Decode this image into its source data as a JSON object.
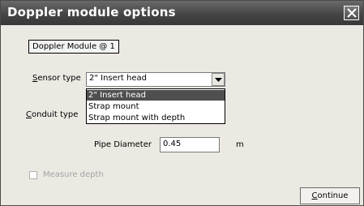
{
  "window": {
    "title": "Doppler module options"
  },
  "module": {
    "label": "Doppler Module @ 1"
  },
  "sensor": {
    "label": "Sensor type",
    "selected": "2\" Insert head",
    "options": [
      "2\" Insert head",
      "Strap mount",
      "Strap mount with depth"
    ],
    "highlighted_index": 0
  },
  "conduit": {
    "label": "Conduit type"
  },
  "pipe": {
    "label": "Pipe Diameter",
    "value": "0.45",
    "unit": "m"
  },
  "measure_depth": {
    "label": "Measure depth",
    "checked": false,
    "enabled": false
  },
  "buttons": {
    "continue": "Continue"
  },
  "colors": {
    "title_bar": "#454545",
    "selection": "#4f4f4f",
    "window_bg": "#ece9e3"
  },
  "icons": {
    "close": "close-x-icon",
    "dropdown_arrow": "chevron-down-icon"
  }
}
